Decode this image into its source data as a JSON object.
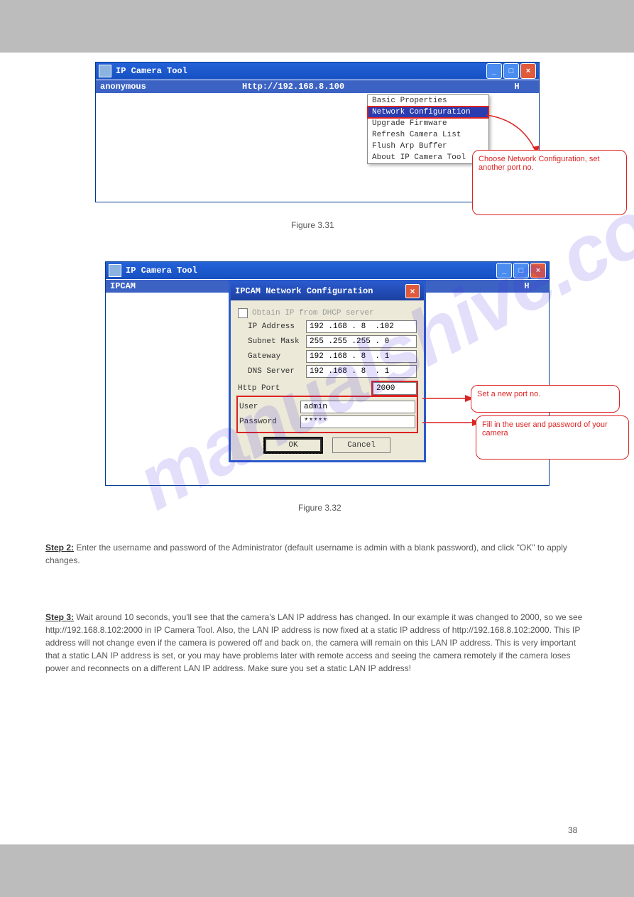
{
  "win_title": "IP Camera Tool",
  "cam_list": {
    "name": "anonymous",
    "url": "Http://192.168.8.100",
    "col3": "H"
  },
  "ctx_menu": [
    "Basic Properties",
    "Network Configuration",
    "Upgrade Firmware",
    "Refresh Camera List",
    "Flush Arp Buffer",
    "About IP Camera Tool"
  ],
  "callout1": "Choose Network Configuration, set another port no.",
  "figure_a": "Figure 3.31",
  "win2_cam": "IPCAM",
  "dialog": {
    "title": "IPCAM Network Configuration",
    "dhcp": "Obtain IP from DHCP server",
    "rows": {
      "ip_l": "IP Address",
      "ip_v": "192 .168 . 8  .102",
      "sm_l": "Subnet Mask",
      "sm_v": "255 .255 .255 . 0",
      "gw_l": "Gateway",
      "gw_v": "192 .168 . 8  . 1",
      "dns_l": "DNS Server",
      "dns_v": "192 .168 . 8  . 1",
      "port_l": "Http Port",
      "port_v": "2000",
      "user_l": "User",
      "user_v": "admin",
      "pwd_l": "Password",
      "pwd_v": "*****"
    },
    "ok": "OK",
    "cancel": "Cancel"
  },
  "callout2": "Set a new port no.",
  "callout3": "Fill in the user and password of your camera",
  "figure_b": "Figure 3.32",
  "step2": {
    "head": "Step 2:",
    "body": " Enter the username and password of the Administrator (default username is admin with a blank password), and click \"OK\" to apply changes."
  },
  "step3": {
    "head": "Step 3:",
    "body_a": " Wait around 10 seconds, you'll see that the camera's LAN IP address has changed. In our example it was changed to 2000, so we see http://192.168.8.102:2000 in IP Camera Tool. Also, the LAN IP address is now fixed at a static IP address of http://192.168.8.102:2000. This IP address will not change even if the camera is powered off and back on, the camera will remain on this LAN IP address. This is very important that a static LAN IP address is set, or you may have problems later with remote access and seeing the camera remotely if the camera loses power and reconnects on a different LAN IP address. Make sure you set a static LAN IP address!"
  },
  "page_no": "38"
}
